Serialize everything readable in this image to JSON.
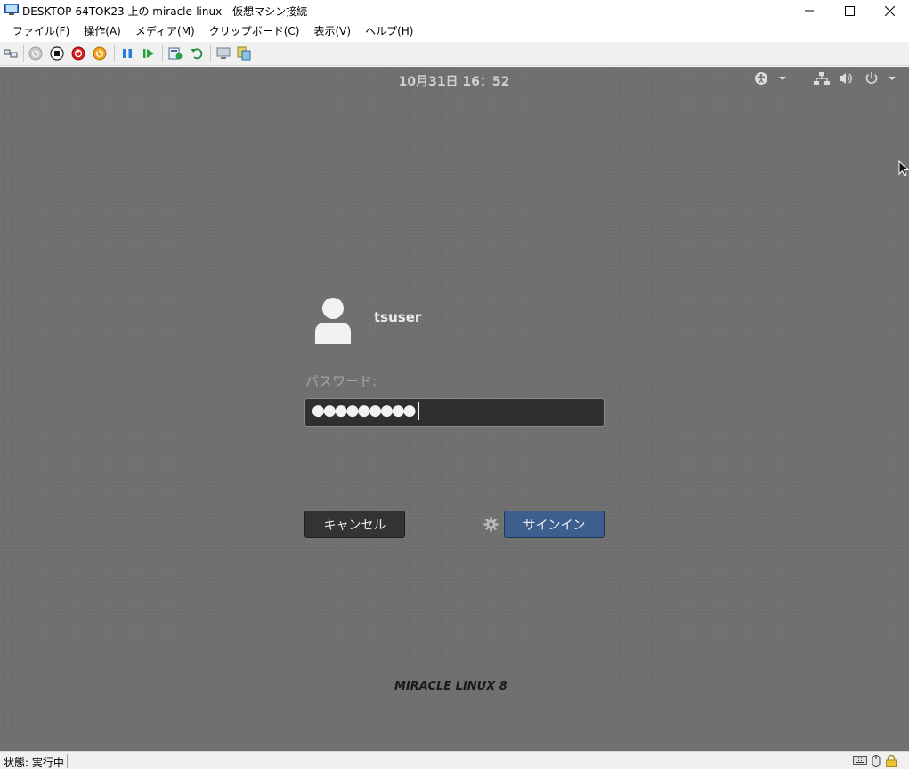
{
  "window": {
    "title": "DESKTOP-64TOK23 上の miracle-linux - 仮想マシン接続"
  },
  "menu": {
    "items": [
      {
        "label": "ファイル(F)"
      },
      {
        "label": "操作(A)"
      },
      {
        "label": "メディア(M)"
      },
      {
        "label": "クリップボード(C)"
      },
      {
        "label": "表示(V)"
      },
      {
        "label": "ヘルプ(H)"
      }
    ]
  },
  "toolbar": {
    "icons": [
      "ctrl-alt-del-icon",
      "start-icon",
      "turn-off-icon",
      "shutdown-icon",
      "save-icon",
      "pause-icon",
      "reset-icon",
      "checkpoint-icon",
      "revert-icon",
      "enhanced-session-icon",
      "share-icon"
    ]
  },
  "vm": {
    "clock": "10月31日 16：52",
    "user": {
      "name": "tsuser"
    },
    "password_label": "パスワード:",
    "password_value": "●●●●●●●●●",
    "cancel_label": "キャンセル",
    "signin_label": "サインイン",
    "brand": "MIRACLE LINUX 8"
  },
  "status": {
    "text": "状態: 実行中"
  },
  "colors": {
    "vm_background": "#6f6f6f",
    "signin_button": "#3d5f8f",
    "cancel_button": "#333333",
    "password_field": "#2f2f2f"
  }
}
